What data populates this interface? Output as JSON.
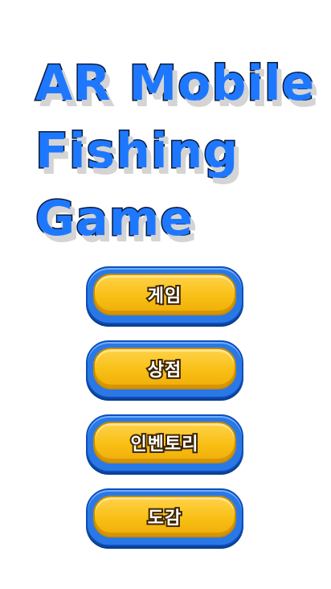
{
  "title": {
    "lines": [
      "AR Mobile",
      "Fishing",
      "Game"
    ]
  },
  "menu": {
    "items": [
      {
        "label": "게임"
      },
      {
        "label": "상점"
      },
      {
        "label": "인벤토리"
      },
      {
        "label": "도감"
      }
    ]
  },
  "colors": {
    "title_fill": "#1e78ff",
    "title_outline": "#0b1b3a",
    "button_border": "#2a78e6",
    "button_face": "#f8bf14"
  }
}
